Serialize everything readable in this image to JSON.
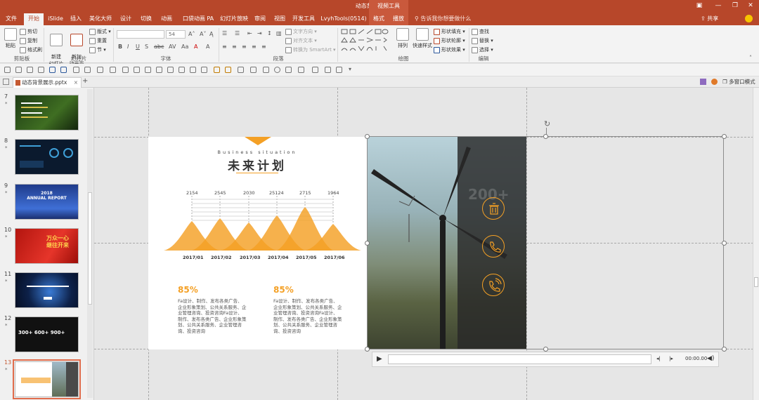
{
  "window": {
    "doc_title": "动态背景展示.pptx",
    "context_tool": "视频工具"
  },
  "tabs": [
    "文件",
    "开始",
    "iSlide",
    "插入",
    "美化大师",
    "设计",
    "切换",
    "动画",
    "口袋动画 PA",
    "幻灯片放映",
    "审阅",
    "视图",
    "开发工具",
    "LvyhTools(0514)",
    "格式",
    "播放"
  ],
  "active_tab": "开始",
  "tellme": "告诉我你想要做什么",
  "share": "共享",
  "ribbon": {
    "clipboard": {
      "paste": "粘贴",
      "cut": "剪切",
      "copy": "复制",
      "format_painter": "格式刷",
      "label": "剪贴板"
    },
    "slides": {
      "new_slide": "新建\n幻灯片",
      "new_anim": "新加\n动画页",
      "layout": "版式",
      "reset": "重置",
      "section": "节",
      "label": "幻灯片"
    },
    "font": {
      "size": "54",
      "label": "字体"
    },
    "paragraph": {
      "text_direction": "文字方向",
      "align_text": "对齐文本",
      "smartart": "转换为 SmartArt",
      "label": "段落"
    },
    "drawing": {
      "arrange": "排列",
      "quick_styles": "快速样式",
      "fill": "形状填充",
      "outline": "形状轮廓",
      "effects": "形状效果",
      "label": "绘图"
    },
    "editing": {
      "find": "查找",
      "replace": "替换",
      "select": "选择",
      "label": "编辑"
    }
  },
  "doc_tab": "动态背景展示.pptx",
  "multi_window": "多窗口模式",
  "thumbnails": [
    {
      "num": "7",
      "star": "*"
    },
    {
      "num": "8",
      "star": "*"
    },
    {
      "num": "9",
      "star": "*",
      "text": "2018\nANNUAL REPORT"
    },
    {
      "num": "10",
      "star": "*",
      "text": "万众一心 继往开来"
    },
    {
      "num": "11",
      "star": "*"
    },
    {
      "num": "12",
      "star": "*",
      "text": "300+  600+  900+"
    },
    {
      "num": "13",
      "star": "*"
    }
  ],
  "slide": {
    "subtitle": "Business situation",
    "title": "未来计划",
    "peaks": [
      "2154",
      "2545",
      "2030",
      "25124",
      "2715",
      "1964"
    ],
    "dates": [
      "2017/01",
      "2017/02",
      "2017/03",
      "2017/04",
      "2017/05",
      "2017/06"
    ],
    "left_pct": "85%",
    "right_pct": "85%",
    "left_para": "Fa设计、制作、发布各类广告、企业形象策划、公共关系服务、企业管理咨询、投资咨询Fa设计、制作、发布各类广告、企业形象策划、公共关系服务、企业管理咨询、投资咨询",
    "right_para": "Fa设计、制作、发布各类广告、企业形象策划、公共关系服务、企业管理咨询、投资咨询Fa设计、制作、发布各类广告、企业形象策划、公共关系服务、企业管理咨询、投资咨询",
    "overlay_num": "200+",
    "accent": "#f4a025"
  },
  "player": {
    "time": "00:00.00"
  }
}
